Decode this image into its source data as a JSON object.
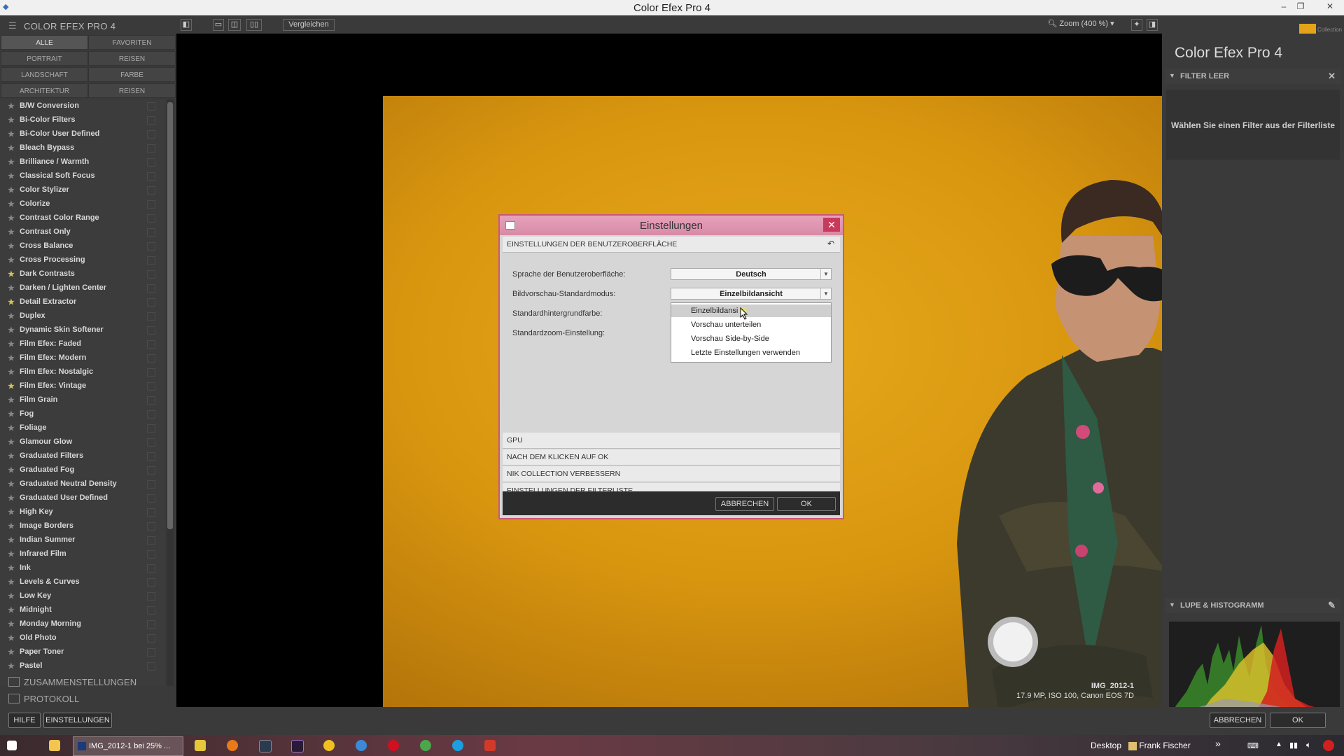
{
  "window": {
    "title": "Color Efex Pro 4"
  },
  "left_panel": {
    "app_header": "COLOR EFEX PRO 4",
    "categories": [
      "ALLE",
      "FAVORITEN",
      "PORTRAIT",
      "REISEN",
      "LANDSCHAFT",
      "FARBE",
      "ARCHITEKTUR",
      "REISEN"
    ],
    "filters": [
      {
        "label": "B/W Conversion",
        "fav": false
      },
      {
        "label": "Bi-Color Filters",
        "fav": false
      },
      {
        "label": "Bi-Color User Defined",
        "fav": false
      },
      {
        "label": "Bleach Bypass",
        "fav": false
      },
      {
        "label": "Brilliance / Warmth",
        "fav": false
      },
      {
        "label": "Classical Soft Focus",
        "fav": false
      },
      {
        "label": "Color Stylizer",
        "fav": false
      },
      {
        "label": "Colorize",
        "fav": false
      },
      {
        "label": "Contrast Color Range",
        "fav": false
      },
      {
        "label": "Contrast Only",
        "fav": false
      },
      {
        "label": "Cross Balance",
        "fav": false
      },
      {
        "label": "Cross Processing",
        "fav": false
      },
      {
        "label": "Dark Contrasts",
        "fav": true
      },
      {
        "label": "Darken / Lighten Center",
        "fav": false
      },
      {
        "label": "Detail Extractor",
        "fav": true
      },
      {
        "label": "Duplex",
        "fav": false
      },
      {
        "label": "Dynamic Skin Softener",
        "fav": false
      },
      {
        "label": "Film Efex: Faded",
        "fav": false
      },
      {
        "label": "Film Efex: Modern",
        "fav": false
      },
      {
        "label": "Film Efex: Nostalgic",
        "fav": false
      },
      {
        "label": "Film Efex: Vintage",
        "fav": true
      },
      {
        "label": "Film Grain",
        "fav": false
      },
      {
        "label": "Fog",
        "fav": false
      },
      {
        "label": "Foliage",
        "fav": false
      },
      {
        "label": "Glamour Glow",
        "fav": false
      },
      {
        "label": "Graduated Filters",
        "fav": false
      },
      {
        "label": "Graduated Fog",
        "fav": false
      },
      {
        "label": "Graduated Neutral Density",
        "fav": false
      },
      {
        "label": "Graduated User Defined",
        "fav": false
      },
      {
        "label": "High Key",
        "fav": false
      },
      {
        "label": "Image Borders",
        "fav": false
      },
      {
        "label": "Indian Summer",
        "fav": false
      },
      {
        "label": "Infrared Film",
        "fav": false
      },
      {
        "label": "Ink",
        "fav": false
      },
      {
        "label": "Levels & Curves",
        "fav": false
      },
      {
        "label": "Low Key",
        "fav": false
      },
      {
        "label": "Midnight",
        "fav": false
      },
      {
        "label": "Monday Morning",
        "fav": false
      },
      {
        "label": "Old Photo",
        "fav": false
      },
      {
        "label": "Paper Toner",
        "fav": false
      },
      {
        "label": "Pastel",
        "fav": false
      }
    ],
    "sections": {
      "collections": "ZUSAMMENSTELLUNGEN",
      "history": "PROTOKOLL"
    }
  },
  "toolbar": {
    "compare_label": "Vergleichen",
    "zoom_label": "Zoom (400 %)"
  },
  "image": {
    "name": "IMG_2012-1",
    "info": "17.9 MP, ISO 100, Canon EOS 7D"
  },
  "dialog": {
    "title": "Einstellungen",
    "close": "✕",
    "sections": {
      "ui": "EINSTELLUNGEN DER BENUTZEROBERFLÄCHE",
      "gpu": "GPU",
      "after_ok": "NACH DEM KLICKEN AUF OK",
      "improve": "NIK COLLECTION VERBESSERN",
      "filterlist": "EINSTELLUNGEN DER FILTERLISTE"
    },
    "settings": {
      "language_label": "Sprache der Benutzeroberfläche:",
      "language_value": "Deutsch",
      "preview_label": "Bildvorschau-Standardmodus:",
      "preview_value": "Einzelbildansicht",
      "bg_label": "Standardhintergrundfarbe:",
      "zoom_label": "Standardzoom-Einstellung:"
    },
    "dropdown_options": [
      "Einzelbildansi",
      "Vorschau unterteilen",
      "Vorschau Side-by-Side",
      "Letzte Einstellungen verwenden"
    ],
    "cancel": "ABBRECHEN",
    "ok": "OK"
  },
  "right_panel": {
    "logo_text": "Collection",
    "product": "Color Efex Pro 4",
    "filter_section": "FILTER LEER",
    "filter_hint": "Wählen Sie einen Filter aus der Filterliste",
    "histogram_section": "LUPE & HISTOGRAMM"
  },
  "bottom_bar": {
    "help": "HILFE",
    "settings": "EINSTELLUNGEN",
    "cancel": "ABBRECHEN",
    "ok": "OK"
  },
  "taskbar": {
    "active_task": "IMG_2012-1 bei 25% ...",
    "desktop": "Desktop",
    "user": "Frank Fischer",
    "more": "»"
  },
  "colors": {
    "accent": "#c8587a",
    "background": "#d8960f",
    "panel": "#3a3a3a"
  }
}
